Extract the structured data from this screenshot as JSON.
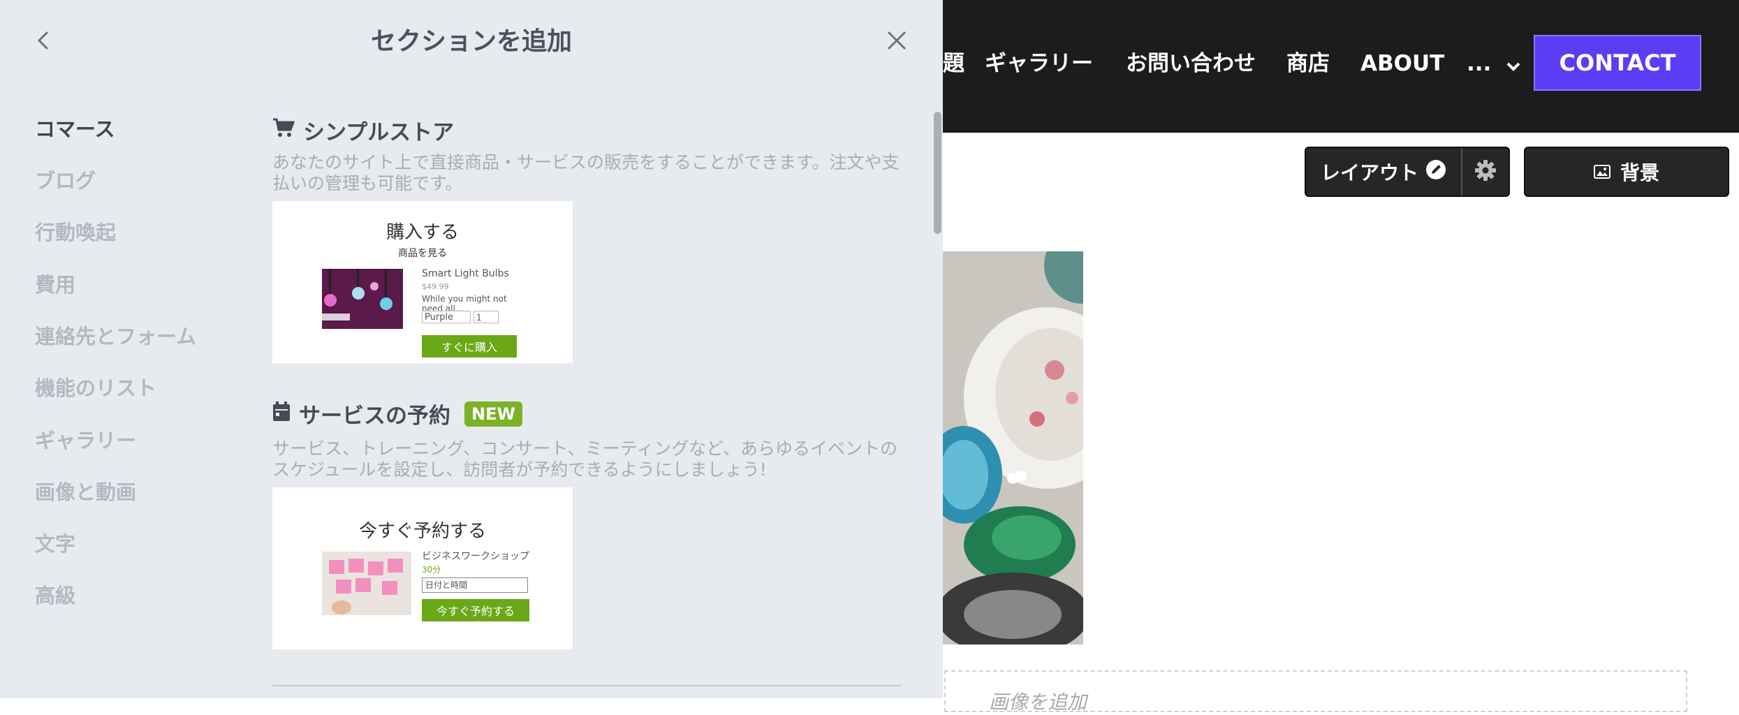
{
  "site": {
    "nav": {
      "partial_item": "題",
      "items": [
        "ギャラリー",
        "お問い合わせ",
        "商店",
        "ABOUT"
      ],
      "more_label": "...",
      "contact_label": "CONTACT",
      "contact_color": "#5b3df5"
    },
    "toolbar": {
      "layout_label": "レイアウト",
      "background_label": "背景"
    },
    "add_image_label": "画像を追加"
  },
  "panel": {
    "title": "セクションを追加",
    "categories": [
      "コマース",
      "ブログ",
      "行動喚起",
      "費用",
      "連絡先とフォーム",
      "機能のリスト",
      "ギャラリー",
      "画像と動画",
      "文字",
      "高級"
    ],
    "active_category": "コマース",
    "sections": [
      {
        "title": "シンプルストア",
        "description": "あなたのサイト上で直接商品・サービスの販売をすることができます。注文や支払いの管理も可能です。",
        "preview": {
          "heading": "購入する",
          "subheading": "商品を見る",
          "product_name": "Smart Light Bulbs",
          "price": "$49.99",
          "desc": "While you might not need all...",
          "option": "Purple",
          "quantity": "1",
          "button": "すぐに購入"
        }
      },
      {
        "title": "サービスの予約",
        "badge": "NEW",
        "description": "サービス、トレーニング、コンサート、ミーティングなど、あらゆるイベントのスケジュールを設定し、訪問者が予約できるようにしましょう!",
        "preview": {
          "heading": "今すぐ予約する",
          "service_name": "ビジネスワークショップ",
          "duration": "30分",
          "datetime_placeholder": "日付と時間",
          "button": "今すぐ予約する"
        }
      }
    ]
  },
  "colors": {
    "panel_bg": "#e7ebf0",
    "accent_green": "#6aa818",
    "nav_bg": "#1c1c1c"
  }
}
